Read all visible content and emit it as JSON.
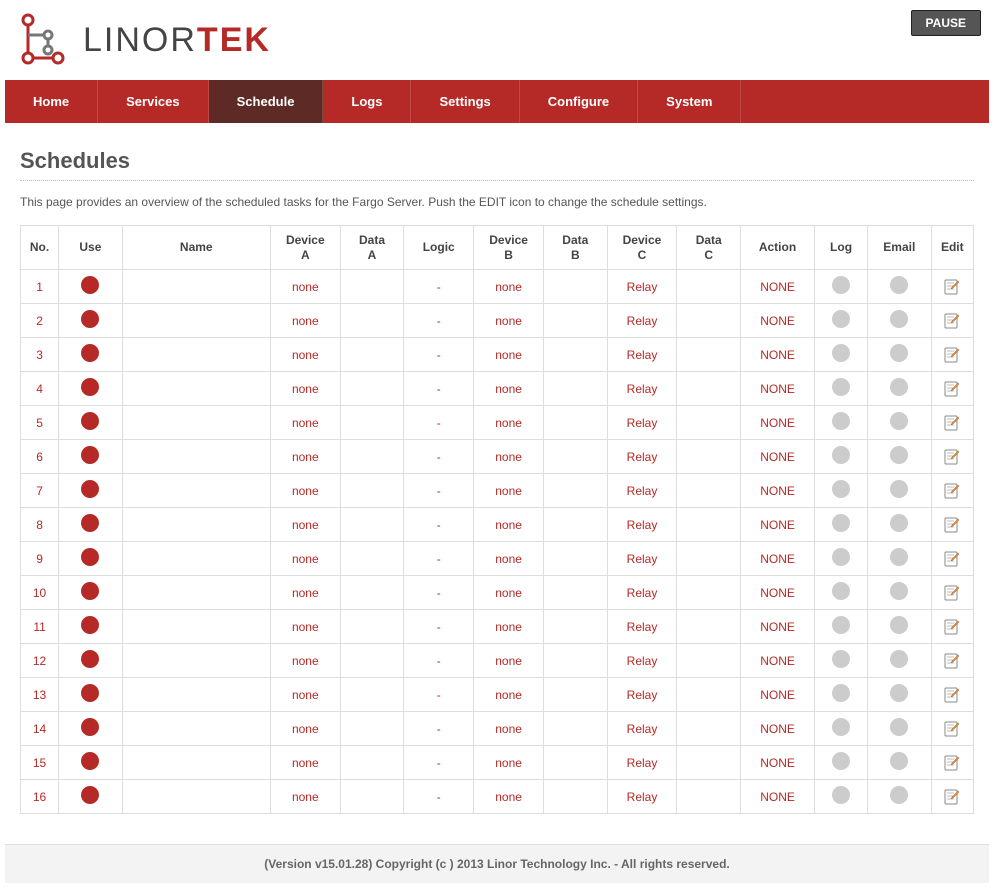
{
  "brand": {
    "part1": "LINOR",
    "part2": "TEK"
  },
  "pause_label": "PAUSE",
  "nav": {
    "items": [
      {
        "label": "Home",
        "active": false
      },
      {
        "label": "Services",
        "active": false
      },
      {
        "label": "Schedule",
        "active": true
      },
      {
        "label": "Logs",
        "active": false
      },
      {
        "label": "Settings",
        "active": false
      },
      {
        "label": "Configure",
        "active": false
      },
      {
        "label": "System",
        "active": false
      }
    ]
  },
  "page": {
    "title": "Schedules",
    "description": "This page provides an overview of the scheduled tasks for the Fargo Server. Push the EDIT icon to change the schedule settings."
  },
  "table": {
    "headers": {
      "no": "No.",
      "use": "Use",
      "name": "Name",
      "deviceA": "Device A",
      "dataA": "Data A",
      "logic": "Logic",
      "deviceB": "Device B",
      "dataB": "Data B",
      "deviceC": "Device C",
      "dataC": "Data C",
      "action": "Action",
      "log": "Log",
      "email": "Email",
      "edit": "Edit"
    },
    "rows": [
      {
        "no": "1",
        "name": "",
        "deviceA": "none",
        "dataA": "",
        "logic": "-",
        "deviceB": "none",
        "dataB": "",
        "deviceC": "Relay",
        "dataC": "",
        "action": "NONE"
      },
      {
        "no": "2",
        "name": "",
        "deviceA": "none",
        "dataA": "",
        "logic": "-",
        "deviceB": "none",
        "dataB": "",
        "deviceC": "Relay",
        "dataC": "",
        "action": "NONE"
      },
      {
        "no": "3",
        "name": "",
        "deviceA": "none",
        "dataA": "",
        "logic": "-",
        "deviceB": "none",
        "dataB": "",
        "deviceC": "Relay",
        "dataC": "",
        "action": "NONE"
      },
      {
        "no": "4",
        "name": "",
        "deviceA": "none",
        "dataA": "",
        "logic": "-",
        "deviceB": "none",
        "dataB": "",
        "deviceC": "Relay",
        "dataC": "",
        "action": "NONE"
      },
      {
        "no": "5",
        "name": "",
        "deviceA": "none",
        "dataA": "",
        "logic": "-",
        "deviceB": "none",
        "dataB": "",
        "deviceC": "Relay",
        "dataC": "",
        "action": "NONE"
      },
      {
        "no": "6",
        "name": "",
        "deviceA": "none",
        "dataA": "",
        "logic": "-",
        "deviceB": "none",
        "dataB": "",
        "deviceC": "Relay",
        "dataC": "",
        "action": "NONE"
      },
      {
        "no": "7",
        "name": "",
        "deviceA": "none",
        "dataA": "",
        "logic": "-",
        "deviceB": "none",
        "dataB": "",
        "deviceC": "Relay",
        "dataC": "",
        "action": "NONE"
      },
      {
        "no": "8",
        "name": "",
        "deviceA": "none",
        "dataA": "",
        "logic": "-",
        "deviceB": "none",
        "dataB": "",
        "deviceC": "Relay",
        "dataC": "",
        "action": "NONE"
      },
      {
        "no": "9",
        "name": "",
        "deviceA": "none",
        "dataA": "",
        "logic": "-",
        "deviceB": "none",
        "dataB": "",
        "deviceC": "Relay",
        "dataC": "",
        "action": "NONE"
      },
      {
        "no": "10",
        "name": "",
        "deviceA": "none",
        "dataA": "",
        "logic": "-",
        "deviceB": "none",
        "dataB": "",
        "deviceC": "Relay",
        "dataC": "",
        "action": "NONE"
      },
      {
        "no": "11",
        "name": "",
        "deviceA": "none",
        "dataA": "",
        "logic": "-",
        "deviceB": "none",
        "dataB": "",
        "deviceC": "Relay",
        "dataC": "",
        "action": "NONE"
      },
      {
        "no": "12",
        "name": "",
        "deviceA": "none",
        "dataA": "",
        "logic": "-",
        "deviceB": "none",
        "dataB": "",
        "deviceC": "Relay",
        "dataC": "",
        "action": "NONE"
      },
      {
        "no": "13",
        "name": "",
        "deviceA": "none",
        "dataA": "",
        "logic": "-",
        "deviceB": "none",
        "dataB": "",
        "deviceC": "Relay",
        "dataC": "",
        "action": "NONE"
      },
      {
        "no": "14",
        "name": "",
        "deviceA": "none",
        "dataA": "",
        "logic": "-",
        "deviceB": "none",
        "dataB": "",
        "deviceC": "Relay",
        "dataC": "",
        "action": "NONE"
      },
      {
        "no": "15",
        "name": "",
        "deviceA": "none",
        "dataA": "",
        "logic": "-",
        "deviceB": "none",
        "dataB": "",
        "deviceC": "Relay",
        "dataC": "",
        "action": "NONE"
      },
      {
        "no": "16",
        "name": "",
        "deviceA": "none",
        "dataA": "",
        "logic": "-",
        "deviceB": "none",
        "dataB": "",
        "deviceC": "Relay",
        "dataC": "",
        "action": "NONE"
      }
    ]
  },
  "footer": "(Version v15.01.28) Copyright (c ) 2013 Linor Technology Inc. - All rights reserved."
}
